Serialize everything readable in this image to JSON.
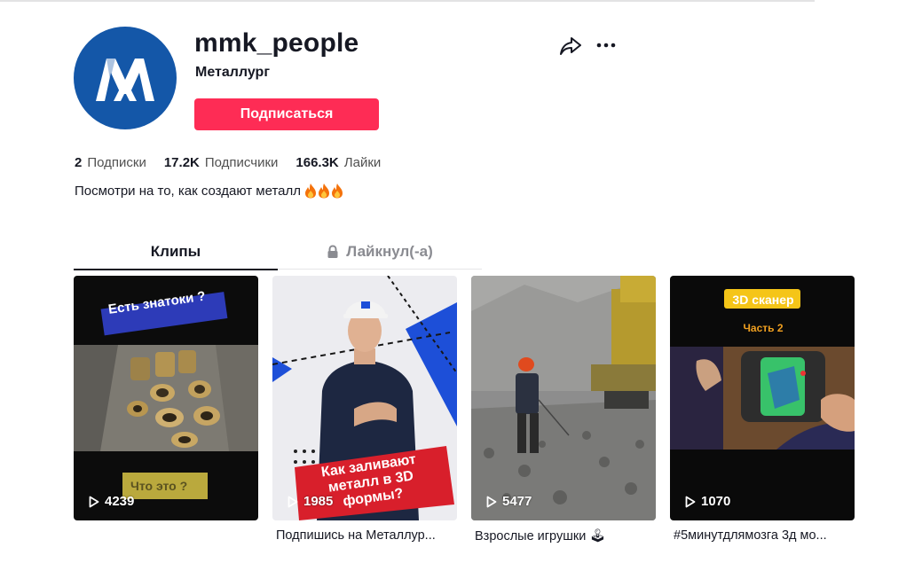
{
  "profile": {
    "username": "mmk_people",
    "nickname": "Металлург",
    "follow_label": "Подписаться",
    "avatar_icon": "mmk-logo-icon",
    "brand_color": "#1457a8",
    "accent_color": "#fe2c55"
  },
  "stats": [
    {
      "value": "2",
      "label": "Подписки"
    },
    {
      "value": "17.2K",
      "label": "Подписчики"
    },
    {
      "value": "166.3K",
      "label": "Лайки"
    }
  ],
  "bio": {
    "text": "Посмотри на то, как создают металл",
    "emoji": "fire-icon x3"
  },
  "tabs": {
    "clips": "Клипы",
    "liked": "Лайкнул(-а)"
  },
  "videos": [
    {
      "views": "4239",
      "overlay_top": "Есть знатоки ?",
      "overlay_bottom": "Что это ?",
      "caption": ""
    },
    {
      "views": "1985",
      "overlay": "Как заливают металл в 3D формы?",
      "caption": "Подпишись на Металлур..."
    },
    {
      "views": "5477",
      "caption": "Взрослые игрушки 🕹"
    },
    {
      "views": "1070",
      "overlay_top": "3D сканер",
      "overlay_sub": "Часть 2",
      "caption": "#5минутдлямозга 3д мо..."
    }
  ]
}
